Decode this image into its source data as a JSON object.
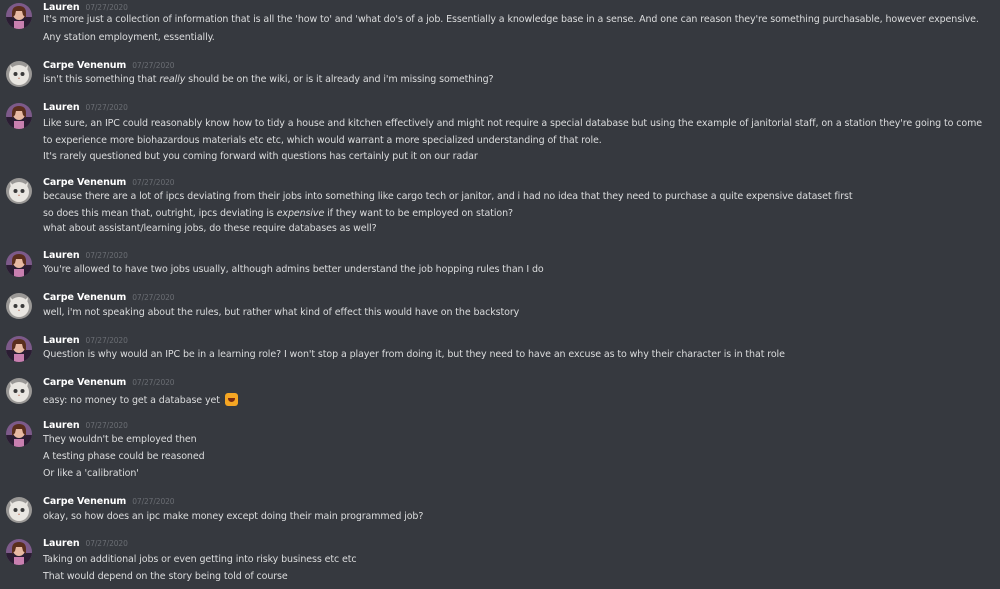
{
  "users": {
    "lauren": "Lauren",
    "carpe": "Carpe Venenum"
  },
  "date": "07/27/2020",
  "messages": [
    {
      "author": "Lauren",
      "timestamp": "07/27/2020",
      "lines": [
        "It's more just a collection of information that is all the 'how to' and 'what do's of a job. Essentially a knowledge base in a sense. And one can reason they're something purchasable, however expensive.",
        "Any station employment, essentially."
      ]
    },
    {
      "author": "Carpe Venenum",
      "timestamp": "07/27/2020",
      "lines": [
        "isn't this something that really should be on the wiki, or is it already and i'm missing something?"
      ]
    },
    {
      "author": "Lauren",
      "timestamp": "07/27/2020",
      "lines": [
        "Like sure, an IPC could reasonably know how to tidy a house and kitchen effectively and might not require a special database but using the example of janitorial staff, on a station they're going to come to experience more biohazardous materials etc etc, which would warrant a more specialized understanding of that role.",
        "It's rarely questioned but you coming forward with questions has certainly put it on our radar"
      ]
    },
    {
      "author": "Carpe Venenum",
      "timestamp": "07/27/2020",
      "lines": [
        "because there are a lot of ipcs deviating from their jobs into something like cargo tech or janitor, and i had no idea that they need to purchase a quite expensive dataset first",
        "so does this mean that, outright, ipcs deviating is expensive if they want to be employed on station?",
        "what about assistant/learning jobs, do these require databases as well?"
      ]
    },
    {
      "author": "Lauren",
      "timestamp": "07/27/2020",
      "lines": [
        "You're allowed to have two jobs usually, although admins better understand the job hopping rules than I do"
      ]
    },
    {
      "author": "Carpe Venenum",
      "timestamp": "07/27/2020",
      "lines": [
        "well, i'm not speaking about the rules, but rather what kind of effect this would have on the backstory"
      ]
    },
    {
      "author": "Lauren",
      "timestamp": "07/27/2020",
      "lines": [
        "Question is why would an IPC be in a learning role? I won't stop a player from doing it, but they need to have an excuse as to why their character is in that role"
      ]
    },
    {
      "author": "Carpe Venenum",
      "timestamp": "07/27/2020",
      "lines": [
        "easy: no money to get a database yet"
      ],
      "emoji": "scream-emoji"
    },
    {
      "author": "Lauren",
      "timestamp": "07/27/2020",
      "lines": [
        "They wouldn't be employed then",
        "A testing phase could be reasoned",
        "Or like a 'calibration'"
      ]
    },
    {
      "author": "Carpe Venenum",
      "timestamp": "07/27/2020",
      "lines": [
        "okay, so how does an ipc make money except doing their main programmed job?"
      ]
    },
    {
      "author": "Lauren",
      "timestamp": "07/27/2020",
      "lines": [
        "Taking on additional jobs or even getting into risky business etc etc",
        "That would depend on the story being told of course"
      ]
    }
  ],
  "colors": {
    "background": "#36393f",
    "text": "#dcddde",
    "author": "#ffffff",
    "timestamp": "#6a6d73"
  }
}
